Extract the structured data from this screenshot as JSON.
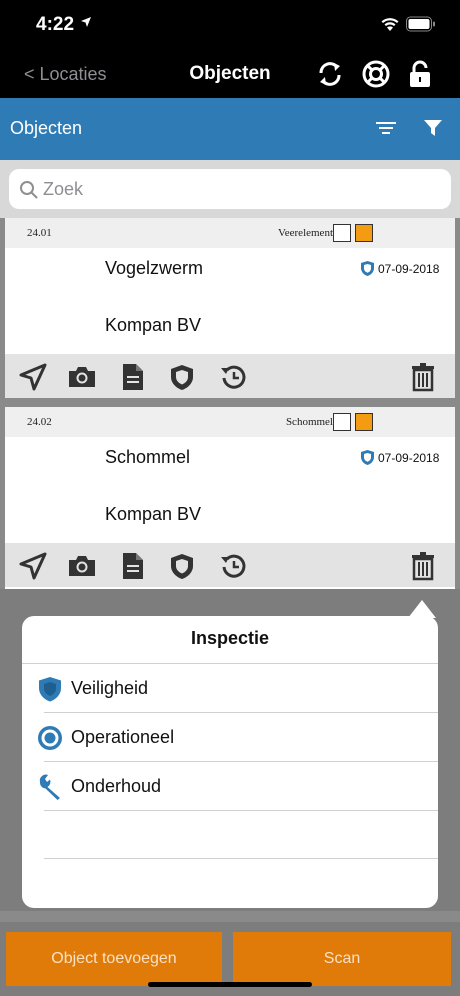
{
  "status": {
    "time": "4:22"
  },
  "nav": {
    "back_label": "< Locaties",
    "title": "Objecten"
  },
  "subheader": {
    "label": "Objecten"
  },
  "search": {
    "placeholder": "Zoek",
    "value": ""
  },
  "objects": [
    {
      "code": "24.01",
      "type": "Veerelement",
      "name": "Vogelzwerm",
      "date": "07-09-2018",
      "company": "Kompan BV"
    },
    {
      "code": "24.02",
      "type": "Schommel",
      "name": "Schommel",
      "date": "07-09-2018",
      "company": "Kompan BV"
    }
  ],
  "popover": {
    "title": "Inspectie",
    "items": [
      {
        "label": "Veiligheid",
        "icon": "shield-icon"
      },
      {
        "label": "Operationeel",
        "icon": "target-icon"
      },
      {
        "label": "Onderhoud",
        "icon": "wrench-icon"
      }
    ]
  },
  "buttons": {
    "add_label": "Object toevoegen",
    "scan_label": "Scan"
  },
  "colors": {
    "header_blue": "#2f7bb5",
    "accent_orange": "#e07b0a",
    "checkbox_orange": "#f39c12"
  }
}
